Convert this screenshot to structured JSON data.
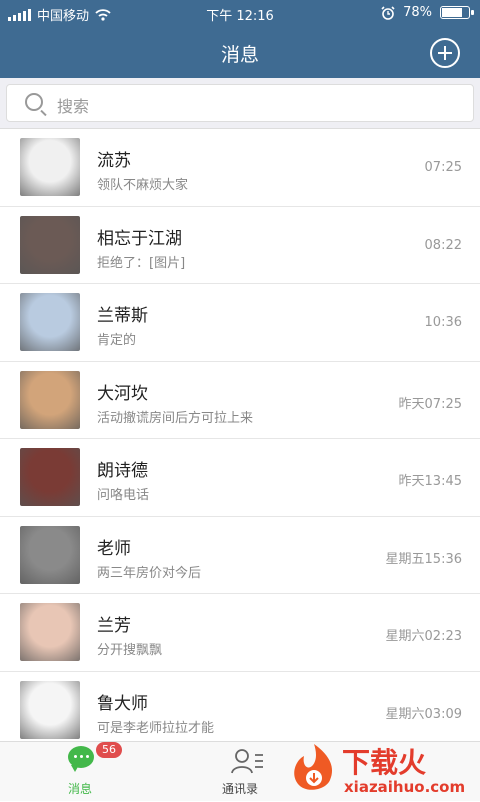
{
  "status_bar": {
    "carrier": "中国移动",
    "time": "下午 12:16",
    "battery": "78%",
    "battery_level": 0.78
  },
  "nav": {
    "title": "消息"
  },
  "search": {
    "placeholder": "搜索"
  },
  "conversations": [
    {
      "name": "流苏",
      "message": "领队不麻烦大家",
      "time": "07:25"
    },
    {
      "name": "相忘于江湖",
      "message": "拒绝了：[图片]",
      "time": "08:22"
    },
    {
      "name": "兰蒂斯",
      "message": "肯定的",
      "time": "10:36"
    },
    {
      "name": "大河坎",
      "message": "活动撤谎房间后方可拉上来",
      "time": "昨天07:25"
    },
    {
      "name": "朗诗德",
      "message": "问咯电话",
      "time": "昨天13:45"
    },
    {
      "name": "老师",
      "message": "两三年房价对今后",
      "time": "星期五15:36"
    },
    {
      "name": "兰芳",
      "message": "分开搜飘飘",
      "time": "星期六02:23"
    },
    {
      "name": "鲁大师",
      "message": "可是李老师拉拉才能",
      "time": "星期六03:09"
    }
  ],
  "avatar_colors": [
    "#f0f0f0",
    "#6b5a55",
    "#b9cbe0",
    "#d2a47a",
    "#7a3b35",
    "#8a8a8a",
    "#e8c6b5",
    "#f5f5f5"
  ],
  "tab_bar": {
    "messages_label": "消息",
    "messages_badge": "56",
    "contacts_label": "通讯录"
  },
  "watermark": {
    "brand": "下载火",
    "site": "xiazaihuo.com"
  },
  "colors": {
    "nav_bg": "#3f6b92",
    "active_tab": "#43b84a",
    "badge": "#e04d4d"
  }
}
